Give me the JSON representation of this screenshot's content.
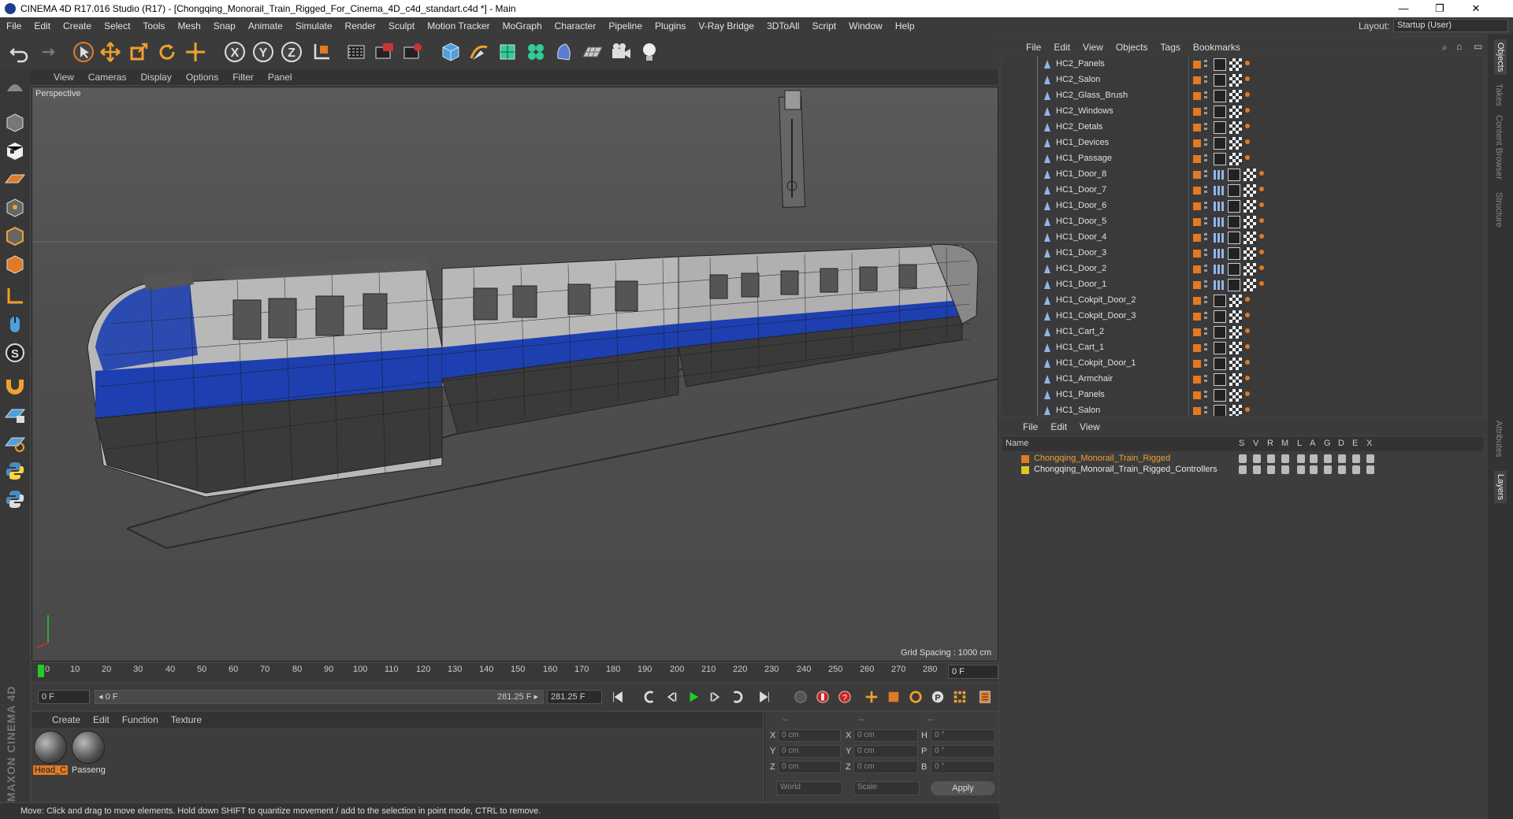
{
  "window": {
    "title": "CINEMA 4D R17.016 Studio (R17) - [Chongqing_Monorail_Train_Rigged_For_Cinema_4D_c4d_standart.c4d *] - Main",
    "min_glyph": "—",
    "max_glyph": "❐",
    "close_glyph": "✕"
  },
  "menu": [
    "File",
    "Edit",
    "Create",
    "Select",
    "Tools",
    "Mesh",
    "Snap",
    "Animate",
    "Simulate",
    "Render",
    "Sculpt",
    "Motion Tracker",
    "MoGraph",
    "Character",
    "Pipeline",
    "Plugins",
    "V-Ray Bridge",
    "3DToAll",
    "Script",
    "Window",
    "Help"
  ],
  "layout": {
    "label": "Layout:",
    "value": "Startup (User)"
  },
  "toolbar_icons": [
    "undo-icon",
    "redo-icon",
    "select-arrow-icon",
    "move-icon",
    "scale-icon",
    "rotate-icon",
    "transform-icon",
    "x-axis-icon",
    "y-axis-icon",
    "z-axis-icon",
    "world-coord-icon",
    "render-view-icon",
    "render-picture-icon",
    "render-settings-icon",
    "cube-icon",
    "pen-spline-icon",
    "subdivision-icon",
    "mograph-cloner-icon",
    "deformer-icon",
    "floor-icon",
    "camera-icon",
    "light-icon"
  ],
  "viewport": {
    "menu": [
      "View",
      "Cameras",
      "Display",
      "Options",
      "Filter",
      "Panel"
    ],
    "label": "Perspective",
    "grid_spacing": "Grid Spacing : 1000 cm"
  },
  "timeline": {
    "ticks": [
      "0",
      "10",
      "20",
      "30",
      "40",
      "50",
      "60",
      "70",
      "80",
      "90",
      "100",
      "110",
      "120",
      "130",
      "140",
      "150",
      "160",
      "170",
      "180",
      "190",
      "200",
      "210",
      "220",
      "230",
      "240",
      "250",
      "260",
      "270",
      "280"
    ],
    "current_frame": "0 F"
  },
  "transport": {
    "start_field": "0 F",
    "range_start": "◂ 0 F",
    "range_end": "281.25 F ▸",
    "end_field": "281.25 F"
  },
  "materials": {
    "menu": [
      "Create",
      "Edit",
      "Function",
      "Texture"
    ],
    "items": [
      "Head_C",
      "Passeng"
    ]
  },
  "coords": {
    "headers": [
      "--",
      "--",
      "--"
    ],
    "rows": [
      {
        "a": "X",
        "av": "0 cm",
        "b": "X",
        "bv": "0 cm",
        "c": "H",
        "cv": "0 °"
      },
      {
        "a": "Y",
        "av": "0 cm",
        "b": "Y",
        "bv": "0 cm",
        "c": "P",
        "cv": "0 °"
      },
      {
        "a": "Z",
        "av": "0 cm",
        "b": "Z",
        "bv": "0 cm",
        "c": "B",
        "cv": "0 °"
      }
    ],
    "mode": "World",
    "type": "Scale",
    "apply": "Apply"
  },
  "status": "Move: Click and drag to move elements. Hold down SHIFT to quantize movement / add to the selection in point mode, CTRL to remove.",
  "object_manager": {
    "menu": [
      "File",
      "Edit",
      "View",
      "Objects",
      "Tags",
      "Bookmarks"
    ],
    "objects": [
      {
        "name": "HC2_Panels",
        "door": false
      },
      {
        "name": "HC2_Salon",
        "door": false
      },
      {
        "name": "HC2_Glass_Brush",
        "door": false
      },
      {
        "name": "HC2_Windows",
        "door": false
      },
      {
        "name": "HC2_Detals",
        "door": false
      },
      {
        "name": "HC1_Devices",
        "door": false
      },
      {
        "name": "HC1_Passage",
        "door": false
      },
      {
        "name": "HC1_Door_8",
        "door": true
      },
      {
        "name": "HC1_Door_7",
        "door": true
      },
      {
        "name": "HC1_Door_6",
        "door": true
      },
      {
        "name": "HC1_Door_5",
        "door": true
      },
      {
        "name": "HC1_Door_4",
        "door": true
      },
      {
        "name": "HC1_Door_3",
        "door": true
      },
      {
        "name": "HC1_Door_2",
        "door": true
      },
      {
        "name": "HC1_Door_1",
        "door": true
      },
      {
        "name": "HC1_Cokpit_Door_2",
        "door": false
      },
      {
        "name": "HC1_Cokpit_Door_3",
        "door": false
      },
      {
        "name": "HC1_Cart_2",
        "door": false
      },
      {
        "name": "HC1_Cart_1",
        "door": false
      },
      {
        "name": "HC1_Cokpit_Door_1",
        "door": false
      },
      {
        "name": "HC1_Armchair",
        "door": false
      },
      {
        "name": "HC1_Panels",
        "door": false
      },
      {
        "name": "HC1_Salon",
        "door": false
      }
    ]
  },
  "layer_manager": {
    "menu": [
      "File",
      "Edit",
      "View"
    ],
    "columns": [
      "Name",
      "S",
      "V",
      "R",
      "M",
      "L",
      "A",
      "G",
      "D",
      "E",
      "X"
    ],
    "layers": [
      {
        "name": "Chongqing_Monorail_Train_Rigged",
        "color": "#e07a25",
        "text_color": "#f0a030"
      },
      {
        "name": "Chongqing_Monorail_Train_Rigged_Controllers",
        "color": "#d8c820",
        "text_color": "#e8e8e8"
      }
    ]
  },
  "right_tabs": [
    "Objects",
    "Takes",
    "Content Browser",
    "Structure",
    "Attributes",
    "Layers"
  ]
}
